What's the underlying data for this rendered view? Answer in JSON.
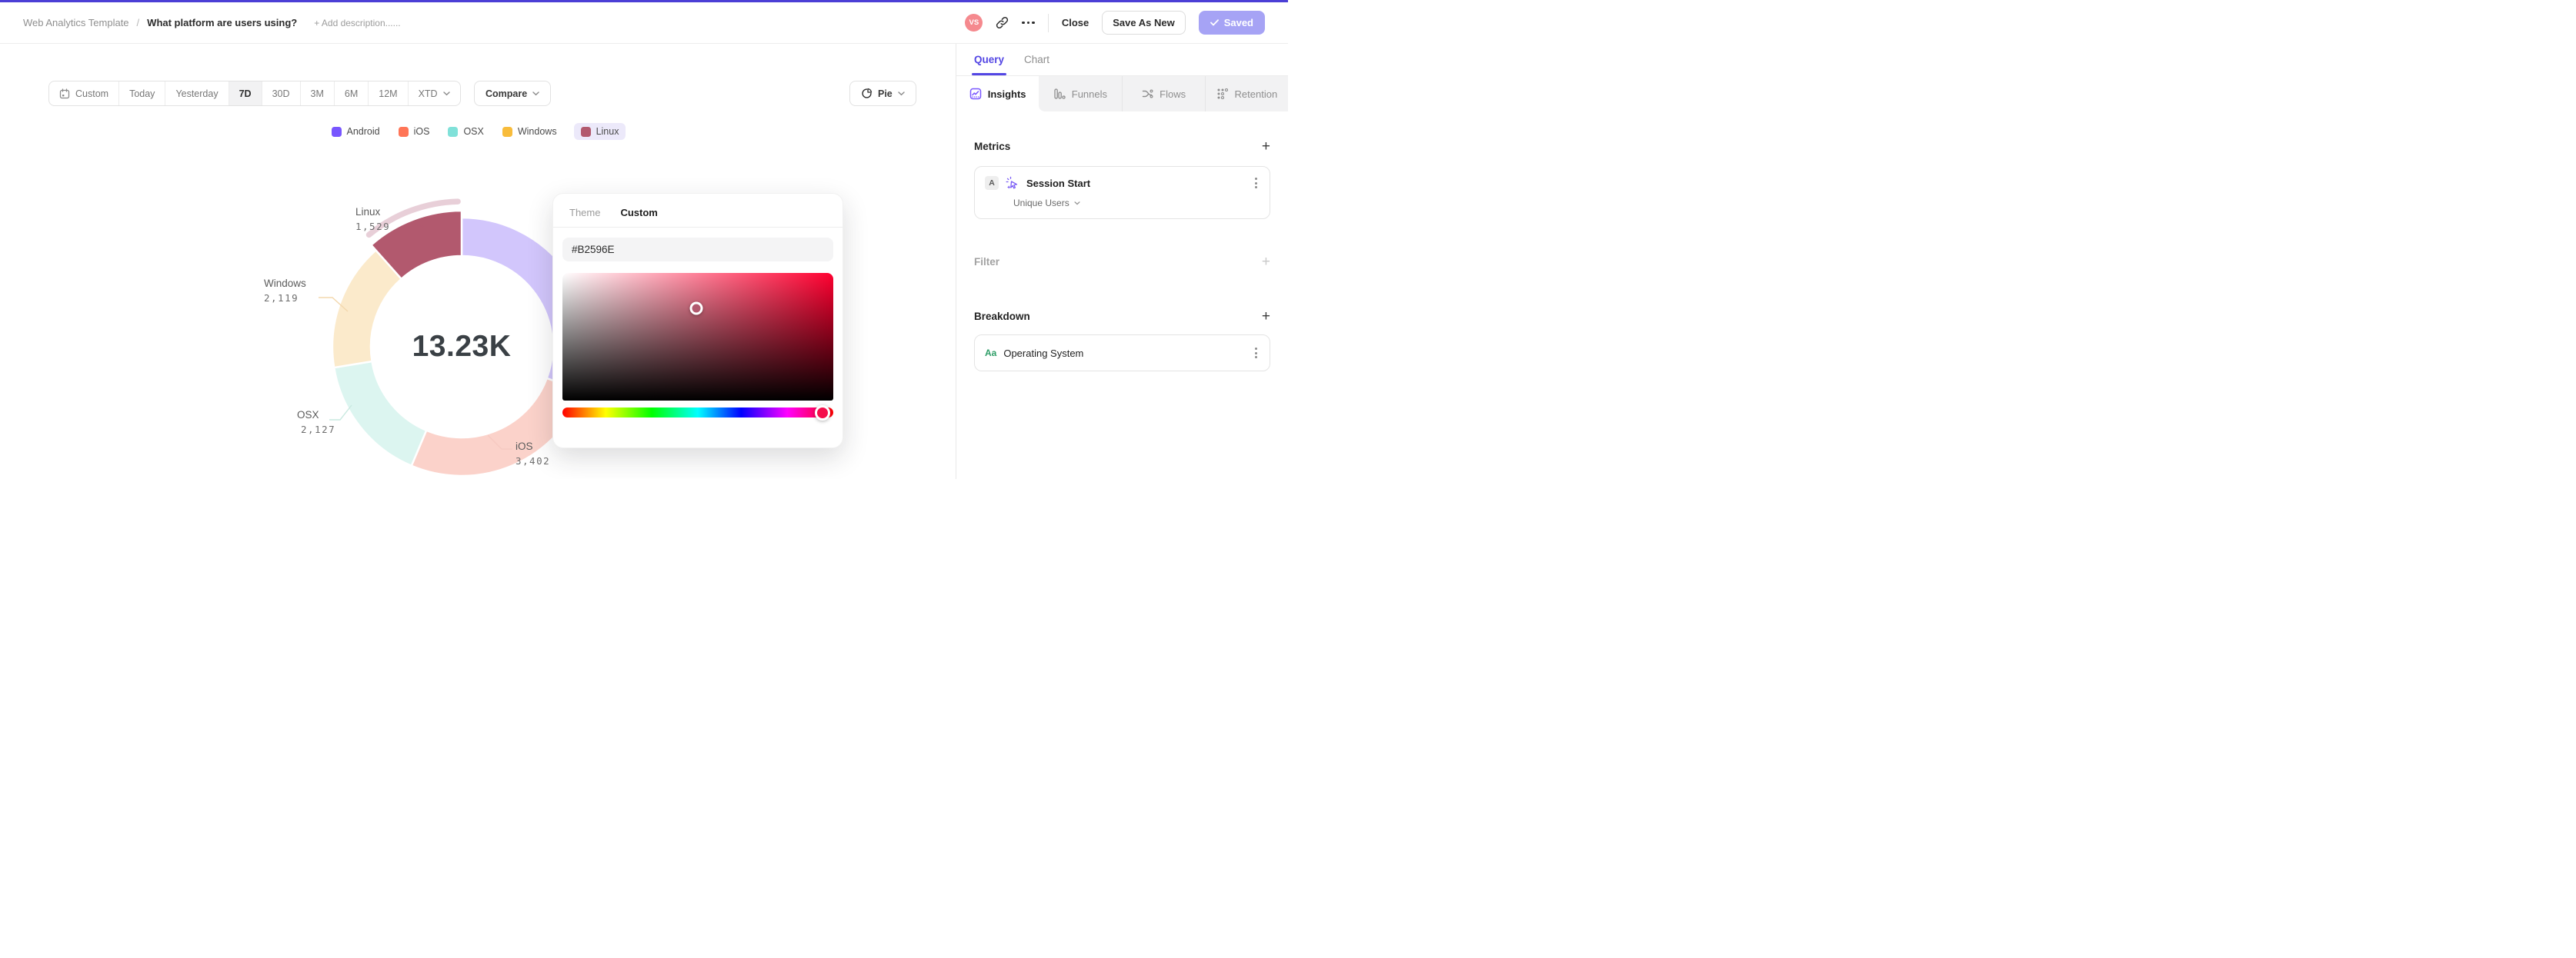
{
  "accent_color": "#4B3FD6",
  "header": {
    "breadcrumb_root": "Web Analytics Template",
    "breadcrumb_separator": "/",
    "title": "What platform are users using?",
    "add_description": "+ Add description......",
    "avatar_initials": "VS",
    "avatar_color": "#F5898E",
    "link_icon": "link-icon",
    "more_icon": "ellipsis-icon",
    "close_label": "Close",
    "save_as_new_label": "Save As New",
    "saved_label": "Saved",
    "saved_check_icon": "check-icon",
    "saved_button_color": "#A6A3F5"
  },
  "toolbar": {
    "calendar_icon": "calendar-icon",
    "date_ranges": [
      "Custom",
      "Today",
      "Yesterday",
      "7D",
      "30D",
      "3M",
      "6M",
      "12M",
      "XTD"
    ],
    "selected_range": "7D",
    "compare_label": "Compare",
    "chart_type_label": "Pie",
    "chart_type_icon": "pie-chart-icon"
  },
  "chart_data": {
    "type": "pie",
    "subtype": "donut",
    "center_total_label": "13.23K",
    "total": 13230,
    "legend_position": "top-center",
    "order_clockwise_from_top": [
      "Android",
      "iOS",
      "OSX",
      "Windows",
      "Linux"
    ],
    "selected_slice": "Linux",
    "selected_band_color": "#E8CFD8",
    "slices": [
      {
        "name": "Android",
        "value": 4053,
        "label": "",
        "label_hidden_behind_popup": true,
        "legend_color": "#7856FF",
        "slice_color": "#D2C6FC",
        "callout_color": ""
      },
      {
        "name": "iOS",
        "value": 3402,
        "label": "3,402",
        "legend_color": "#FF7557",
        "slice_color": "#FBD2CA",
        "callout_color": "#F6C9C1"
      },
      {
        "name": "OSX",
        "value": 2127,
        "label": "2,127",
        "legend_color": "#80E1D9",
        "slice_color": "#DCF5F0",
        "callout_color": "#C9E9E0"
      },
      {
        "name": "Windows",
        "value": 2119,
        "label": "2,119",
        "legend_color": "#F8BC3B",
        "slice_color": "#FBEACB",
        "callout_color": "#F3D8AD"
      },
      {
        "name": "Linux",
        "value": 1529,
        "label": "1,529",
        "selected": true,
        "legend_color": "#B2596E",
        "slice_color": "#B2596E",
        "callout_color": "#B2596E"
      }
    ]
  },
  "color_picker": {
    "tabs": [
      "Theme",
      "Custom"
    ],
    "active_tab": "Custom",
    "hex_value": "#B2596E",
    "saturation_handle": {
      "x_pct": 49.5,
      "y_pct": 28,
      "color": "#B2596E"
    },
    "hue_handle": {
      "pct": 96,
      "color": "#F50D4B"
    }
  },
  "sidebar": {
    "tabs": [
      {
        "label": "Query",
        "active": true
      },
      {
        "label": "Chart",
        "active": false
      }
    ],
    "view_tabs": [
      {
        "label": "Insights",
        "icon": "insights-chart-icon",
        "active": true
      },
      {
        "label": "Funnels",
        "icon": "funnel-bars-icon",
        "active": false
      },
      {
        "label": "Flows",
        "icon": "flows-icon",
        "active": false
      },
      {
        "label": "Retention",
        "icon": "retention-grid-icon",
        "active": false
      }
    ],
    "metrics": {
      "heading": "Metrics",
      "add": "+",
      "card": {
        "series_letter": "A",
        "event_icon": "click-sparkle-icon",
        "event": "Session Start",
        "aggregation": "Unique Users"
      }
    },
    "filter": {
      "heading": "Filter",
      "add": "+"
    },
    "breakdown": {
      "heading": "Breakdown",
      "add": "+",
      "card": {
        "type_badge": "Aa",
        "property": "Operating System"
      }
    }
  }
}
